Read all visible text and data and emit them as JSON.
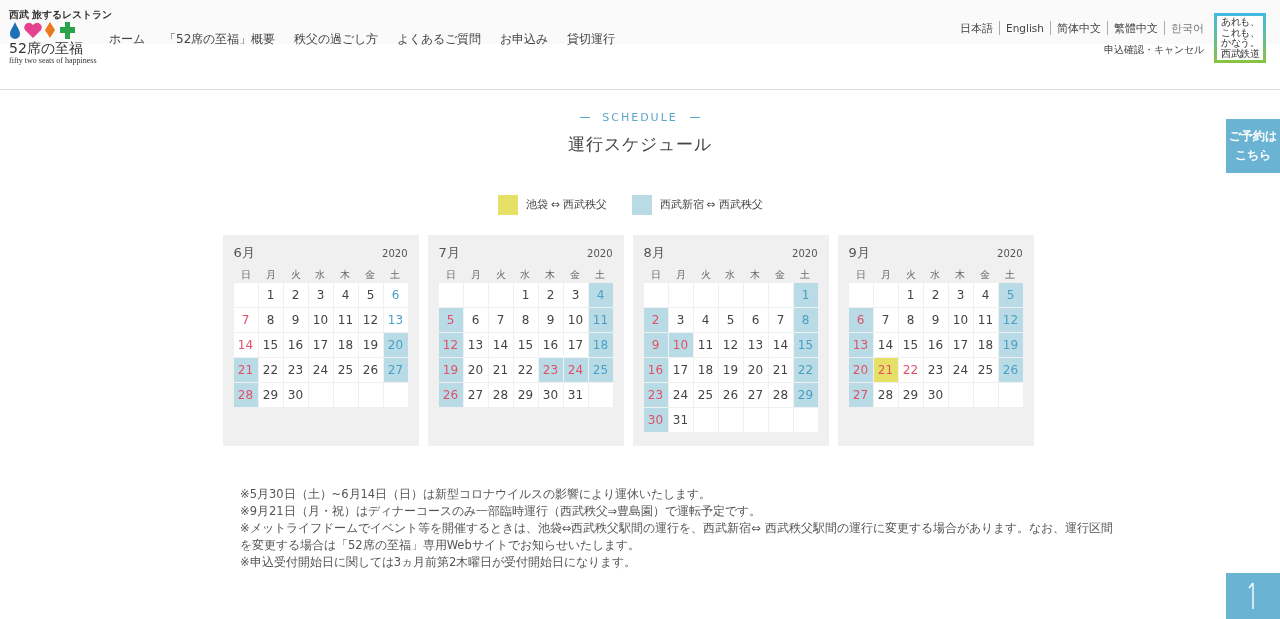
{
  "header": {
    "logo": {
      "tagline": "西武 旅するレストラン",
      "name": "52席の至福",
      "subtitle": "fifty two seats of happiness"
    },
    "nav": [
      "ホーム",
      "「52席の至福」概要",
      "秩父の過ごし方",
      "よくあるご質問",
      "お申込み",
      "貸切運行"
    ],
    "languages": [
      "日本語",
      "English",
      "简体中文",
      "繁體中文",
      "한국어"
    ],
    "account_link": "申込確認・キャンセル",
    "badge": [
      "あれも、",
      "これも、",
      "かなう。",
      "西武鉄道"
    ]
  },
  "section_label": "SCHEDULE",
  "title": "運行スケジュール",
  "legend": [
    {
      "label": "池袋 ⇔ 西武秩父",
      "color": "#e6e066"
    },
    {
      "label": "西武新宿 ⇔ 西武秩父",
      "color": "#b9dbe6"
    }
  ],
  "months": [
    {
      "month": "6月",
      "year": "2020",
      "weekdays": [
        "日",
        "月",
        "火",
        "水",
        "木",
        "金",
        "土"
      ],
      "days": [
        {
          "kind": "blank"
        },
        {
          "kind": "day",
          "day": "1",
          "holiday": false
        },
        {
          "kind": "day",
          "day": "2",
          "holiday": false
        },
        {
          "kind": "day",
          "day": "3",
          "holiday": false
        },
        {
          "kind": "day",
          "day": "4",
          "holiday": false
        },
        {
          "kind": "day",
          "day": "5",
          "holiday": false
        },
        {
          "kind": "day",
          "day": "6",
          "holiday": false
        },
        {
          "kind": "day",
          "day": "7",
          "holiday": true
        },
        {
          "kind": "day",
          "day": "8",
          "holiday": false
        },
        {
          "kind": "day",
          "day": "9",
          "holiday": false
        },
        {
          "kind": "day",
          "day": "10",
          "holiday": false
        },
        {
          "kind": "day",
          "day": "11",
          "holiday": false
        },
        {
          "kind": "day",
          "day": "12",
          "holiday": false
        },
        {
          "kind": "day",
          "day": "13",
          "holiday": false
        },
        {
          "kind": "day",
          "day": "14",
          "holiday": true
        },
        {
          "kind": "day",
          "day": "15",
          "holiday": false
        },
        {
          "kind": "day",
          "day": "16",
          "holiday": false
        },
        {
          "kind": "day",
          "day": "17",
          "holiday": false
        },
        {
          "kind": "day",
          "day": "18",
          "holiday": false
        },
        {
          "kind": "day",
          "day": "19",
          "holiday": false
        },
        {
          "kind": "day",
          "day": "20",
          "holiday": false,
          "color": "#b9dbe6"
        },
        {
          "kind": "day",
          "day": "21",
          "holiday": true,
          "color": "#b9dbe6"
        },
        {
          "kind": "day",
          "day": "22",
          "holiday": false
        },
        {
          "kind": "day",
          "day": "23",
          "holiday": false
        },
        {
          "kind": "day",
          "day": "24",
          "holiday": false
        },
        {
          "kind": "day",
          "day": "25",
          "holiday": false
        },
        {
          "kind": "day",
          "day": "26",
          "holiday": false
        },
        {
          "kind": "day",
          "day": "27",
          "holiday": false,
          "color": "#b9dbe6"
        },
        {
          "kind": "day",
          "day": "28",
          "holiday": true,
          "color": "#b9dbe6"
        },
        {
          "kind": "day",
          "day": "29",
          "holiday": false
        },
        {
          "kind": "day",
          "day": "30",
          "holiday": false
        }
      ]
    },
    {
      "month": "7月",
      "year": "2020",
      "weekdays": [
        "日",
        "月",
        "火",
        "水",
        "木",
        "金",
        "土"
      ],
      "days": [
        {
          "kind": "blank"
        },
        {
          "kind": "blank"
        },
        {
          "kind": "blank"
        },
        {
          "kind": "day",
          "day": "1",
          "holiday": false
        },
        {
          "kind": "day",
          "day": "2",
          "holiday": false
        },
        {
          "kind": "day",
          "day": "3",
          "holiday": false
        },
        {
          "kind": "day",
          "day": "4",
          "holiday": false,
          "color": "#b9dbe6"
        },
        {
          "kind": "day",
          "day": "5",
          "holiday": true,
          "color": "#b9dbe6"
        },
        {
          "kind": "day",
          "day": "6",
          "holiday": false
        },
        {
          "kind": "day",
          "day": "7",
          "holiday": false
        },
        {
          "kind": "day",
          "day": "8",
          "holiday": false
        },
        {
          "kind": "day",
          "day": "9",
          "holiday": false
        },
        {
          "kind": "day",
          "day": "10",
          "holiday": false
        },
        {
          "kind": "day",
          "day": "11",
          "holiday": false,
          "color": "#b9dbe6"
        },
        {
          "kind": "day",
          "day": "12",
          "holiday": true,
          "color": "#b9dbe6"
        },
        {
          "kind": "day",
          "day": "13",
          "holiday": false
        },
        {
          "kind": "day",
          "day": "14",
          "holiday": false
        },
        {
          "kind": "day",
          "day": "15",
          "holiday": false
        },
        {
          "kind": "day",
          "day": "16",
          "holiday": false
        },
        {
          "kind": "day",
          "day": "17",
          "holiday": false
        },
        {
          "kind": "day",
          "day": "18",
          "holiday": false,
          "color": "#b9dbe6"
        },
        {
          "kind": "day",
          "day": "19",
          "holiday": true,
          "color": "#b9dbe6"
        },
        {
          "kind": "day",
          "day": "20",
          "holiday": false
        },
        {
          "kind": "day",
          "day": "21",
          "holiday": false
        },
        {
          "kind": "day",
          "day": "22",
          "holiday": false
        },
        {
          "kind": "day",
          "day": "23",
          "holiday": true,
          "color": "#b9dbe6"
        },
        {
          "kind": "day",
          "day": "24",
          "holiday": true,
          "color": "#b9dbe6"
        },
        {
          "kind": "day",
          "day": "25",
          "holiday": false,
          "color": "#b9dbe6"
        },
        {
          "kind": "day",
          "day": "26",
          "holiday": true,
          "color": "#b9dbe6"
        },
        {
          "kind": "day",
          "day": "27",
          "holiday": false
        },
        {
          "kind": "day",
          "day": "28",
          "holiday": false
        },
        {
          "kind": "day",
          "day": "29",
          "holiday": false
        },
        {
          "kind": "day",
          "day": "30",
          "holiday": false
        },
        {
          "kind": "day",
          "day": "31",
          "holiday": false
        }
      ]
    },
    {
      "month": "8月",
      "year": "2020",
      "weekdays": [
        "日",
        "月",
        "火",
        "水",
        "木",
        "金",
        "土"
      ],
      "days": [
        {
          "kind": "blank"
        },
        {
          "kind": "blank"
        },
        {
          "kind": "blank"
        },
        {
          "kind": "blank"
        },
        {
          "kind": "blank"
        },
        {
          "kind": "blank"
        },
        {
          "kind": "day",
          "day": "1",
          "holiday": false,
          "color": "#b9dbe6"
        },
        {
          "kind": "day",
          "day": "2",
          "holiday": true,
          "color": "#b9dbe6"
        },
        {
          "kind": "day",
          "day": "3",
          "holiday": false
        },
        {
          "kind": "day",
          "day": "4",
          "holiday": false
        },
        {
          "kind": "day",
          "day": "5",
          "holiday": false
        },
        {
          "kind": "day",
          "day": "6",
          "holiday": false
        },
        {
          "kind": "day",
          "day": "7",
          "holiday": false
        },
        {
          "kind": "day",
          "day": "8",
          "holiday": false,
          "color": "#b9dbe6"
        },
        {
          "kind": "day",
          "day": "9",
          "holiday": true,
          "color": "#b9dbe6"
        },
        {
          "kind": "day",
          "day": "10",
          "holiday": true,
          "color": "#b9dbe6"
        },
        {
          "kind": "day",
          "day": "11",
          "holiday": false
        },
        {
          "kind": "day",
          "day": "12",
          "holiday": false
        },
        {
          "kind": "day",
          "day": "13",
          "holiday": false
        },
        {
          "kind": "day",
          "day": "14",
          "holiday": false
        },
        {
          "kind": "day",
          "day": "15",
          "holiday": false,
          "color": "#b9dbe6"
        },
        {
          "kind": "day",
          "day": "16",
          "holiday": true,
          "color": "#b9dbe6"
        },
        {
          "kind": "day",
          "day": "17",
          "holiday": false
        },
        {
          "kind": "day",
          "day": "18",
          "holiday": false
        },
        {
          "kind": "day",
          "day": "19",
          "holiday": false
        },
        {
          "kind": "day",
          "day": "20",
          "holiday": false
        },
        {
          "kind": "day",
          "day": "21",
          "holiday": false
        },
        {
          "kind": "day",
          "day": "22",
          "holiday": false,
          "color": "#b9dbe6"
        },
        {
          "kind": "day",
          "day": "23",
          "holiday": true,
          "color": "#b9dbe6"
        },
        {
          "kind": "day",
          "day": "24",
          "holiday": false
        },
        {
          "kind": "day",
          "day": "25",
          "holiday": false
        },
        {
          "kind": "day",
          "day": "26",
          "holiday": false
        },
        {
          "kind": "day",
          "day": "27",
          "holiday": false
        },
        {
          "kind": "day",
          "day": "28",
          "holiday": false
        },
        {
          "kind": "day",
          "day": "29",
          "holiday": false,
          "color": "#b9dbe6"
        },
        {
          "kind": "day",
          "day": "30",
          "holiday": true,
          "color": "#b9dbe6"
        },
        {
          "kind": "day",
          "day": "31",
          "holiday": false
        }
      ]
    },
    {
      "month": "9月",
      "year": "2020",
      "weekdays": [
        "日",
        "月",
        "火",
        "水",
        "木",
        "金",
        "土"
      ],
      "days": [
        {
          "kind": "blank"
        },
        {
          "kind": "blank"
        },
        {
          "kind": "day",
          "day": "1",
          "holiday": false
        },
        {
          "kind": "day",
          "day": "2",
          "holiday": false
        },
        {
          "kind": "day",
          "day": "3",
          "holiday": false
        },
        {
          "kind": "day",
          "day": "4",
          "holiday": false
        },
        {
          "kind": "day",
          "day": "5",
          "holiday": false,
          "color": "#b9dbe6"
        },
        {
          "kind": "day",
          "day": "6",
          "holiday": true,
          "color": "#b9dbe6"
        },
        {
          "kind": "day",
          "day": "7",
          "holiday": false
        },
        {
          "kind": "day",
          "day": "8",
          "holiday": false
        },
        {
          "kind": "day",
          "day": "9",
          "holiday": false
        },
        {
          "kind": "day",
          "day": "10",
          "holiday": false
        },
        {
          "kind": "day",
          "day": "11",
          "holiday": false
        },
        {
          "kind": "day",
          "day": "12",
          "holiday": false,
          "color": "#b9dbe6"
        },
        {
          "kind": "day",
          "day": "13",
          "holiday": true,
          "color": "#b9dbe6"
        },
        {
          "kind": "day",
          "day": "14",
          "holiday": false
        },
        {
          "kind": "day",
          "day": "15",
          "holiday": false
        },
        {
          "kind": "day",
          "day": "16",
          "holiday": false
        },
        {
          "kind": "day",
          "day": "17",
          "holiday": false
        },
        {
          "kind": "day",
          "day": "18",
          "holiday": false
        },
        {
          "kind": "day",
          "day": "19",
          "holiday": false,
          "color": "#b9dbe6"
        },
        {
          "kind": "day",
          "day": "20",
          "holiday": true,
          "color": "#b9dbe6"
        },
        {
          "kind": "day",
          "day": "21",
          "holiday": true,
          "color": "#e6e066"
        },
        {
          "kind": "day",
          "day": "22",
          "holiday": true
        },
        {
          "kind": "day",
          "day": "23",
          "holiday": false
        },
        {
          "kind": "day",
          "day": "24",
          "holiday": false
        },
        {
          "kind": "day",
          "day": "25",
          "holiday": false
        },
        {
          "kind": "day",
          "day": "26",
          "holiday": false,
          "color": "#b9dbe6"
        },
        {
          "kind": "day",
          "day": "27",
          "holiday": true,
          "color": "#b9dbe6"
        },
        {
          "kind": "day",
          "day": "28",
          "holiday": false
        },
        {
          "kind": "day",
          "day": "29",
          "holiday": false
        },
        {
          "kind": "day",
          "day": "30",
          "holiday": false
        }
      ]
    }
  ],
  "notes": [
    "※5月30日（土）~6月14日（日）は新型コロナウイルスの影響により運休いたします。",
    "※9月21日（月・祝）はディナーコースのみ一部臨時運行（西武秩父⇒豊島園）で運転予定です。",
    "※メットライフドームでイベント等を開催するときは、池袋⇔西武秩父駅間の運行を、西武新宿⇔ 西武秩父駅間の運行に変更する場合があります。なお、運行区間を変更する場合は「52席の至福」専用Webサイトでお知らせいたします。",
    "※申込受付開始日に関しては3ヵ月前第2木曜日が受付開始日になります。"
  ],
  "reserve_button": "ご予約はこちら"
}
